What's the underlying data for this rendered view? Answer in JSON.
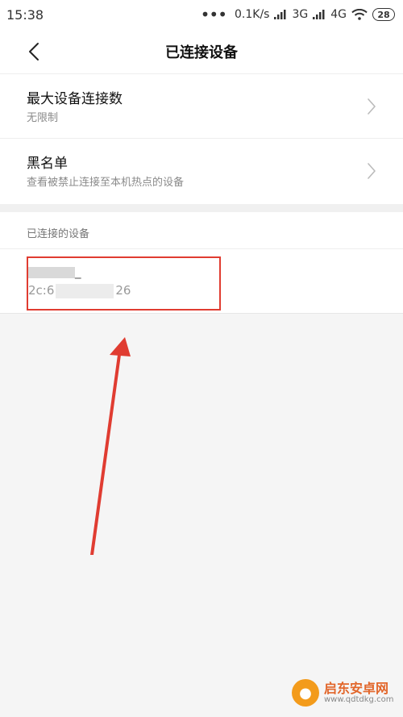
{
  "status_bar": {
    "time": "15:38",
    "network_speed": "0.1K/s",
    "signal1_label": "3G",
    "signal2_label": "4G",
    "battery": "28"
  },
  "header": {
    "title": "已连接设备"
  },
  "settings": [
    {
      "title": "最大设备连接数",
      "subtitle": "无限制"
    },
    {
      "title": "黑名单",
      "subtitle": "查看被禁止连接至本机热点的设备"
    }
  ],
  "connected": {
    "section_label": "已连接的设备",
    "device_mac_prefix": "2c:6",
    "device_mac_suffix": "26"
  },
  "watermark": {
    "title": "启东安卓网",
    "url": "www.qdtdkg.com"
  },
  "colors": {
    "accent_red": "#e03c31"
  }
}
